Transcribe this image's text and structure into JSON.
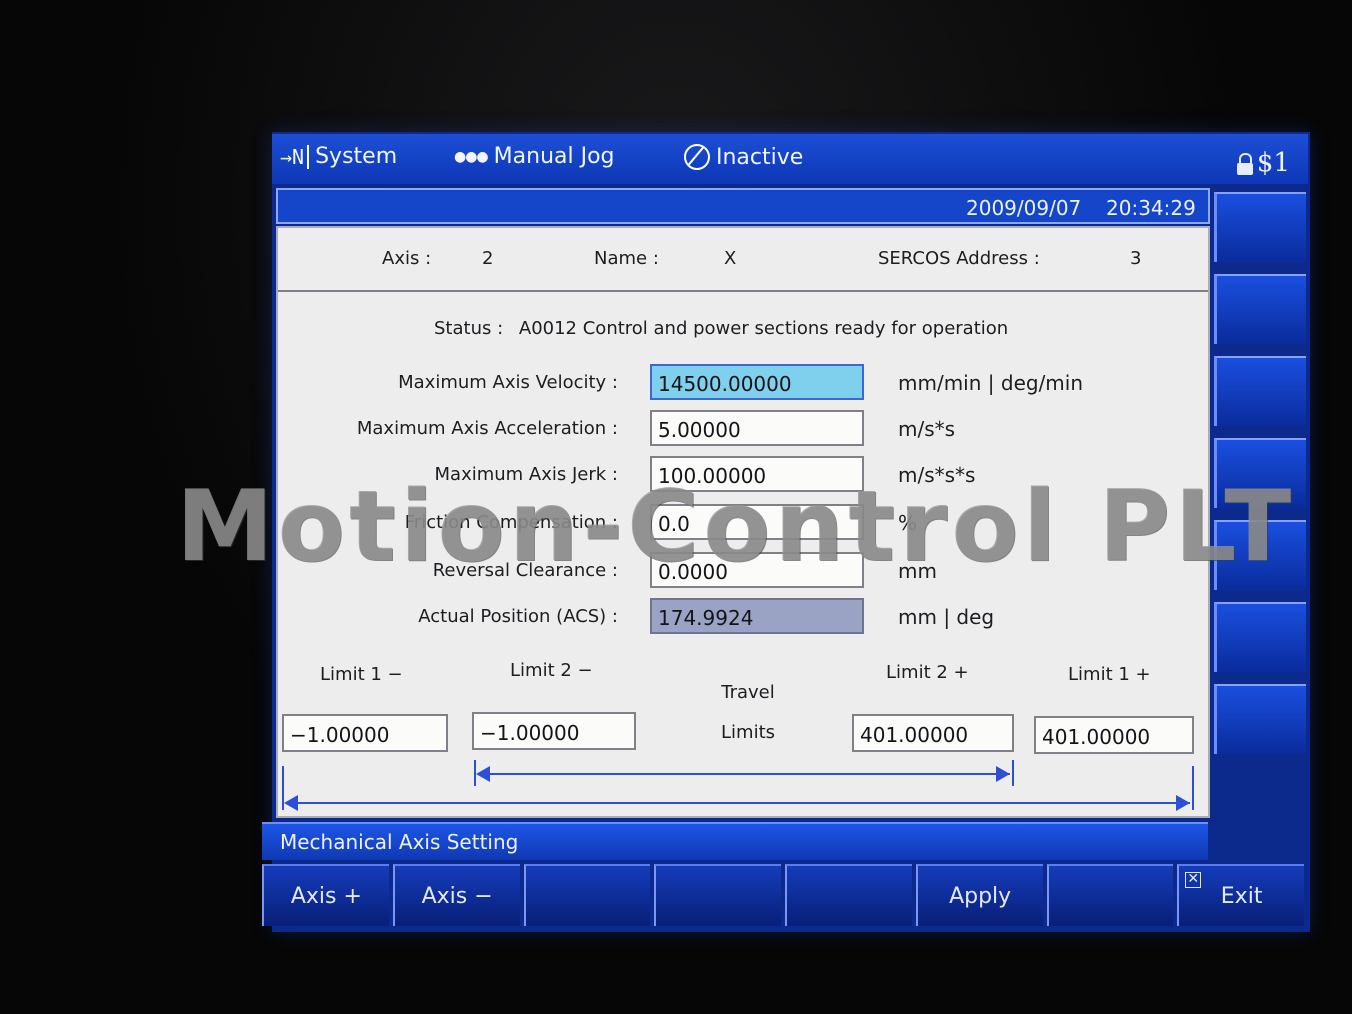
{
  "topbar": {
    "system_label": "System",
    "mode_label": "Manual Jog",
    "state_label": "Inactive",
    "access_label": "$1"
  },
  "datebar": {
    "date": "2009/09/07",
    "time": "20:34:29"
  },
  "header": {
    "axis_label": "Axis :",
    "axis_value": "2",
    "name_label": "Name :",
    "name_value": "X",
    "sercos_label": "SERCOS Address :",
    "sercos_value": "3"
  },
  "status": {
    "label": "Status :",
    "text": "A0012 Control and power sections ready for operation"
  },
  "params": [
    {
      "label": "Maximum Axis Velocity :",
      "value": "14500.00000",
      "unit": "mm/min  |  deg/min"
    },
    {
      "label": "Maximum Axis Acceleration :",
      "value": "5.00000",
      "unit": "m/s*s"
    },
    {
      "label": "Maximum Axis Jerk :",
      "value": "100.00000",
      "unit": "m/s*s*s"
    },
    {
      "label": "Friction Compensation :",
      "value": "0.0",
      "unit": "%"
    },
    {
      "label": "Reversal Clearance :",
      "value": "0.0000",
      "unit": "mm"
    },
    {
      "label": "Actual Position (ACS) :",
      "value": "174.9924",
      "unit": "mm  |  deg"
    }
  ],
  "limits": {
    "limit1_minus_label": "Limit  1  −",
    "limit2_minus_label": "Limit  2  −",
    "limit2_plus_label": "Limit  2  +",
    "limit1_plus_label": "Limit  1  +",
    "limit1_minus": "−1.00000",
    "limit2_minus": "−1.00000",
    "limit2_plus": "401.00000",
    "limit1_plus": "401.00000",
    "travel_label": "Travel",
    "limits_label": "Limits"
  },
  "title": "Mechanical Axis Setting",
  "softkeys": {
    "axis_plus": "Axis +",
    "axis_minus": "Axis −",
    "apply": "Apply",
    "exit": "Exit"
  },
  "watermark": "Motion-Control PLT"
}
